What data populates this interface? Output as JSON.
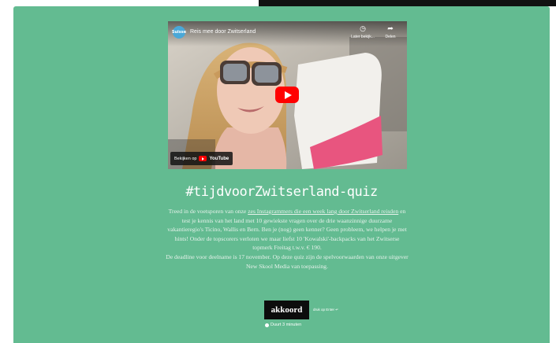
{
  "video": {
    "channel_logo_text": "Suisse",
    "title": "Reis mee door Zwitserland",
    "actions": [
      {
        "icon": "clock-icon",
        "label": "Later bekijk..."
      },
      {
        "icon": "share-icon",
        "label": "Delen"
      }
    ],
    "watch_on_label": "Bekijken op",
    "watch_on_brand": "YouTube"
  },
  "quiz": {
    "title": "#tijdvoorZwitserland-quiz",
    "intro_before_link": "Treed in de voetsporen van onze ",
    "intro_link": "zes Instagrammers die een week lang door Zwitserland reisden",
    "intro_after_link": " en test je kennis van het land met 10 gewiekste vragen over de drie waanzinnige duurzame vakantieregio's Ticino, Wallis en Bern. Ben je (nog) geen kenner? Geen probleem, we helpen je met hints! Onder de topscorers verloten we maar liefst 10 'Kowalski'-backpacks van het Zwitserse topmerk Freitag t.w.v. € 190.",
    "deadline": "De deadline voor deelname is 17 november. Op deze quiz zijn de spelvoorwaarden van onze uitgever New Skool Media van toepassing.",
    "accept_label": "akkoord",
    "accept_note": "druk op Enter ↵",
    "duration": "Duurt 3 minuten"
  },
  "colors": {
    "background": "#63bb91",
    "button": "#0c0c0c",
    "play": "#ff0000"
  }
}
